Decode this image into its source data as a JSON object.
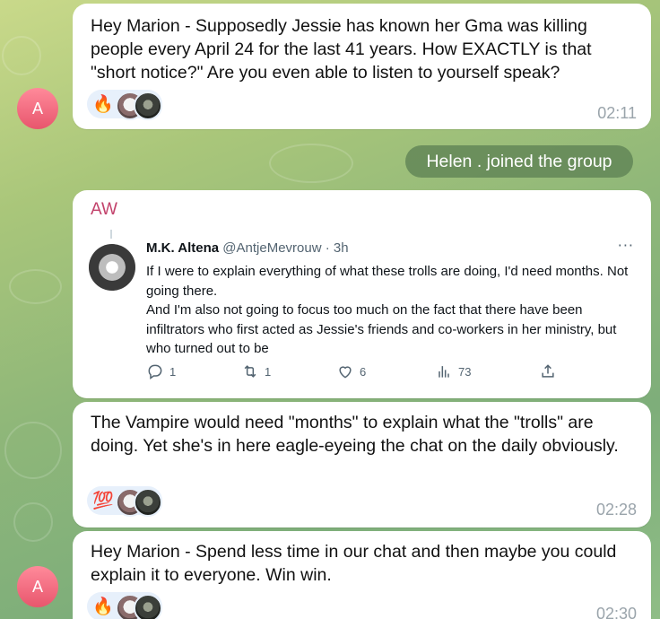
{
  "messages": [
    {
      "avatar_initial": "A",
      "text": "Hey Marion - Supposedly Jessie has known her Gma was killing people every April 24 for the last 41 years.  How EXACTLY is that \"short notice?\"  Are you even able to listen to yourself speak?",
      "reaction_emoji": "🔥",
      "time": "02:11"
    },
    {
      "sender": "AW",
      "tweet": {
        "author_name": "M.K. Altena",
        "handle": "@AntjeMevrouw",
        "age": "3h",
        "paragraph1": "If I were to explain everything of what these trolls are doing, I'd need months. Not going there.",
        "paragraph2": "And I'm also not going to focus too much on the fact that there have been infiltrators who first acted as Jessie's friends and co-workers in her ministry, but who turned out to be",
        "replies": "1",
        "retweets": "1",
        "likes": "6",
        "views": "73",
        "more_icon": "···"
      }
    },
    {
      "text": "The Vampire would need \"months\" to explain what the \"trolls\" are doing.  Yet she's in here eagle-eyeing the chat on the daily obviously.",
      "reaction_emoji": "💯",
      "time": "02:28"
    },
    {
      "avatar_initial": "A",
      "text": "Hey Marion - Spend less time in our chat and then maybe you could explain it to everyone. Win win.",
      "reaction_emoji": "🔥",
      "time": "02:30"
    }
  ],
  "service_message": "Helen . joined the group",
  "colors": {
    "avatar_gradient_top": "#ff8a9a",
    "avatar_gradient_bottom": "#e8566d",
    "sender_name": "#c2426b",
    "time_text": "#9aa4ab",
    "service_bg": "#5d8254",
    "reaction_bg": "#e7f0fb"
  },
  "icons": [
    "reply-icon",
    "retweet-icon",
    "like-icon",
    "views-icon",
    "share-icon"
  ]
}
